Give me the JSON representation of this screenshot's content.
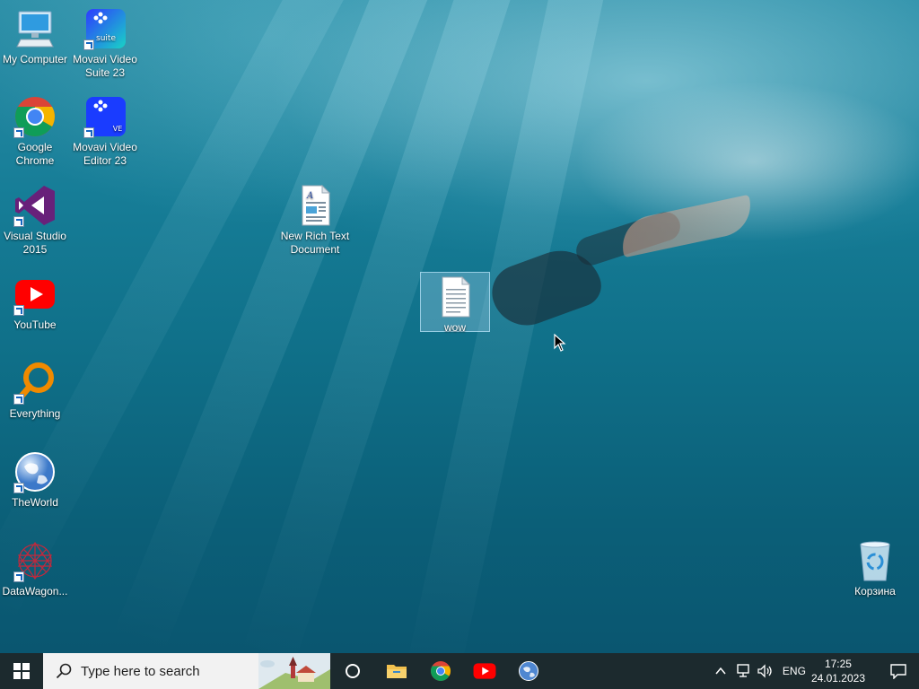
{
  "desktop": {
    "icons": [
      {
        "label": "My Computer",
        "icon": "computer-icon"
      },
      {
        "label": "Movavi Video Suite 23",
        "icon": "movavi-suite-icon",
        "badge": "suite"
      },
      {
        "label": "Google Chrome",
        "icon": "chrome-icon"
      },
      {
        "label": "Movavi Video Editor 23",
        "icon": "movavi-editor-icon",
        "badge": "VE"
      },
      {
        "label": "Visual Studio 2015",
        "icon": "visual-studio-icon"
      },
      {
        "label": "New Rich Text Document",
        "icon": "rich-text-document-icon"
      },
      {
        "label": "wow",
        "icon": "text-document-icon"
      },
      {
        "label": "YouTube",
        "icon": "youtube-icon"
      },
      {
        "label": "Everything",
        "icon": "everything-search-icon"
      },
      {
        "label": "TheWorld",
        "icon": "theworld-browser-icon"
      },
      {
        "label": "DataWagon...",
        "icon": "datawagon-icon"
      },
      {
        "label": "Корзина",
        "icon": "recycle-bin-icon"
      }
    ]
  },
  "taskbar": {
    "search_placeholder": "Type here to search",
    "pinned": [
      {
        "name": "cortana",
        "icon": "cortana-circle-icon"
      },
      {
        "name": "file-explorer",
        "icon": "folder-icon"
      },
      {
        "name": "chrome",
        "icon": "chrome-icon"
      },
      {
        "name": "youtube",
        "icon": "youtube-icon"
      },
      {
        "name": "theworld",
        "icon": "globe-icon"
      }
    ],
    "tray": {
      "language": "ENG",
      "time": "17:25",
      "date": "24.01.2023"
    }
  },
  "colors": {
    "taskbar": "#1c2a2e",
    "chrome_red": "#db4437",
    "chrome_green": "#0f9d58",
    "chrome_yellow": "#f4b400",
    "chrome_blue": "#4285f4",
    "youtube_red": "#ff0000",
    "vs_purple": "#68217a",
    "movavi_blue": "#1a3cff",
    "everything_orange": "#f08a00"
  }
}
